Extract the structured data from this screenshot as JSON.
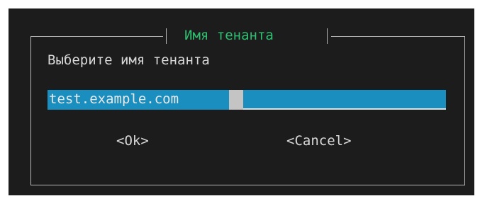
{
  "dialog": {
    "title": "Имя тенанта",
    "prompt": "Выберите имя тенанта",
    "input_value": "test.example.com",
    "ok_label": "<Ok>",
    "cancel_label": "<Cancel>"
  },
  "colors": {
    "background": "#1c1c1c",
    "title": "#2fbf71",
    "input_background": "#1a8fbf",
    "text": "#d8d8d8"
  }
}
